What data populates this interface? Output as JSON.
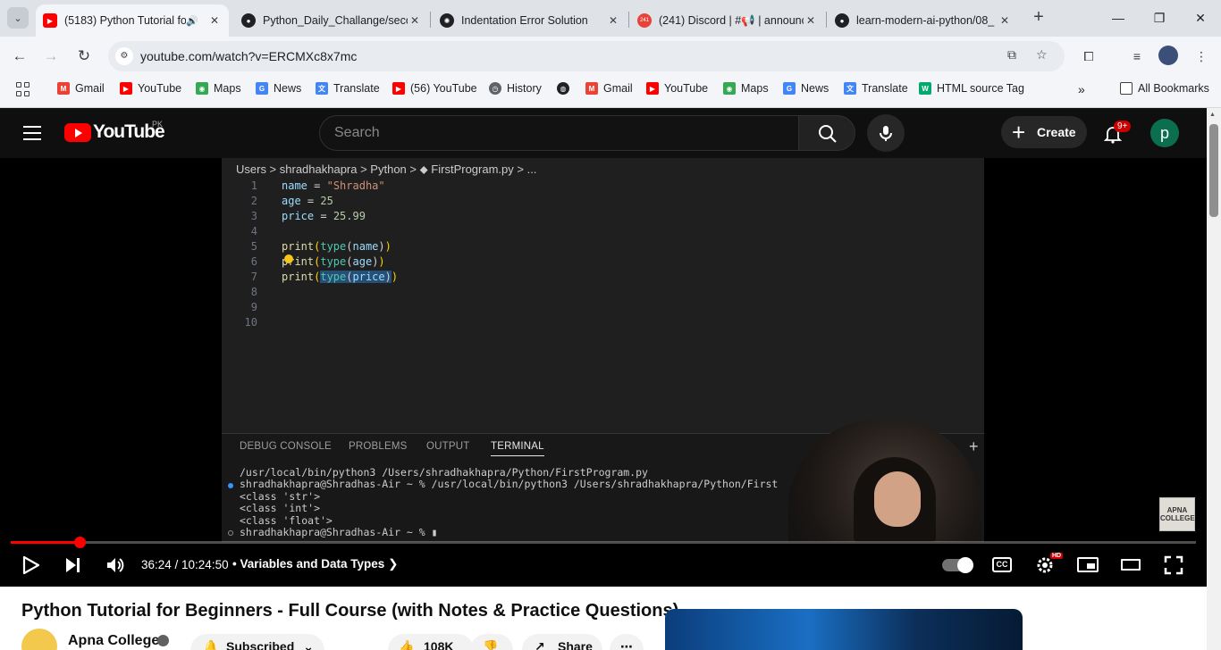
{
  "tabs": [
    {
      "title": "(5183) Python Tutorial fo",
      "active": true
    },
    {
      "title": "Python_Daily_Challange/seco"
    },
    {
      "title": "Indentation Error Solution"
    },
    {
      "title": "(241) Discord | #📢 | announce"
    },
    {
      "title": "learn-modern-ai-python/08_"
    }
  ],
  "discord_badge": "241",
  "address": {
    "url": "youtube.com/watch?v=ERCMXc8x7mc"
  },
  "bookmarks": [
    "Gmail",
    "YouTube",
    "Maps",
    "News",
    "Translate",
    "(56) YouTube",
    "History",
    "Gmail",
    "YouTube",
    "Maps",
    "News",
    "Translate",
    "HTML source Tag"
  ],
  "all_bookmarks": "All Bookmarks",
  "yt_header": {
    "logo_text": "YouTube",
    "country": "PK",
    "search_placeholder": "Search",
    "create_label": "Create",
    "notif_count": "9+",
    "avatar_letter": "p"
  },
  "editor": {
    "breadcrumb": "Users  >  shradhakhapra  >  Python  >  ⬥ FirstProgram.py  >  ...",
    "line_numbers": [
      "1",
      "2",
      "3",
      "4",
      "5",
      "6",
      "7",
      "8",
      "9",
      "10"
    ],
    "panel_tabs": [
      "DEBUG CONSOLE",
      "PROBLEMS",
      "OUTPUT",
      "TERMINAL"
    ],
    "terminal_lines": [
      "/usr/local/bin/python3 /Users/shradhakhapra/Python/FirstProgram.py",
      "shradhakhapra@Shradhas-Air ~ % /usr/local/bin/python3 /Users/shradhakhapra/Python/First",
      "<class 'str'>",
      "<class 'int'>",
      "<class 'float'>",
      "shradhakhapra@Shradhas-Air ~ % ▮"
    ]
  },
  "watermark": "APNA COLLEGE",
  "player": {
    "time": "36:24 / 10:24:50",
    "chapter": "• Variables and Data Types",
    "progress_fraction": 0.058
  },
  "video": {
    "title": "Python Tutorial for Beginners - Full Course (with Notes & Practice Questions)",
    "channel": "Apna College",
    "subscribe_label": "Subscribed",
    "likes": "108K",
    "share_label": "Share"
  }
}
